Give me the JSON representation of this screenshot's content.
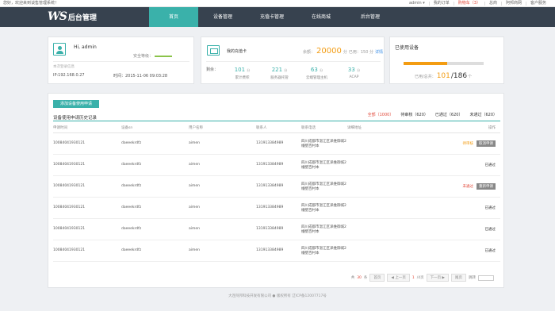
{
  "topbar": {
    "welcome": "您好，欢迎来到谈售管理系统！",
    "links": [
      "admin ▾",
      "我的订单",
      "购物车（3）",
      "总商",
      "阿邦商网",
      "客户服务"
    ]
  },
  "nav": {
    "logo_mark": "WS",
    "logo_text": "后台管理",
    "items": [
      "首页",
      "设备管理",
      "充值卡管理",
      "在线商城",
      "后台管理"
    ]
  },
  "user_card": {
    "greeting": "Hi, admin",
    "security_label": "安全等级：",
    "last_login_label": "本次登录信息",
    "ip": "IP:192.168.0.27",
    "time": "时间：2015-11-06 09:03:28"
  },
  "recharge_card": {
    "title": "我的充值卡",
    "balance_label": "余额：",
    "balance": "20000",
    "balance_unit": "分",
    "used": "已用：150 分",
    "detail": "详情",
    "remaining_label": "剩余：",
    "stats": [
      {
        "value": "101",
        "unit": "分",
        "label": "累计费积"
      },
      {
        "value": "221",
        "unit": "分",
        "label": "服务器托管"
      },
      {
        "value": "63",
        "unit": "分",
        "label": "云端管理主机"
      },
      {
        "value": "33",
        "unit": "分",
        "label": "ACAP"
      }
    ]
  },
  "device_card": {
    "title": "已使用设备",
    "used_fraction": 0.543,
    "count_label": "已用/总共：",
    "used": "101",
    "total": "/186",
    "unit": "个"
  },
  "main": {
    "apply_button": "添加设备使用申请",
    "record_title": "设备使用申请历史记录",
    "filters": [
      "全部（1000）",
      "待审核（620）",
      "已通过（620）",
      "未通过（620）"
    ],
    "columns": [
      "申请时间",
      "设备sn",
      "用户名称",
      "联系人",
      "联系电话",
      "详细地址",
      "操作"
    ],
    "rows": [
      {
        "time": "10084041930121",
        "sn": "daeeekrdfz",
        "user": "aimen",
        "contact": "131913384989",
        "phone": "四川成都市温江区泽维御城2幢壁百村本",
        "status": "待审核",
        "status_class": "wait",
        "action": "取消申请"
      },
      {
        "time": "10084041930121",
        "sn": "daeeekrdfz",
        "user": "aimen",
        "contact": "131913384989",
        "phone": "四川成都市温江区泽维御城2幢壁百村本",
        "status": "已通过",
        "status_class": "",
        "action": ""
      },
      {
        "time": "10084041930121",
        "sn": "daeeekrdfz",
        "user": "aimen",
        "contact": "131913384989",
        "phone": "四川成都市温江区泽维御城2幢壁百村本",
        "status": "未通过",
        "status_class": "no",
        "action": "重新申请"
      },
      {
        "time": "10084041930121",
        "sn": "daeeekrdfz",
        "user": "aimen",
        "contact": "131913384989",
        "phone": "四川成都市温江区泽维御城2幢壁百村本",
        "status": "已通过",
        "status_class": "",
        "action": ""
      },
      {
        "time": "10084041930121",
        "sn": "daeeekrdfz",
        "user": "aimen",
        "contact": "131913384989",
        "phone": "四川成都市温江区泽维御城2幢壁百村本",
        "status": "已通过",
        "status_class": "",
        "action": ""
      },
      {
        "time": "10084041930121",
        "sn": "daeeekrdfz",
        "user": "aimen",
        "contact": "131913384989",
        "phone": "四川成都市温江区泽维御城2幢壁百村本",
        "status": "已通过",
        "status_class": "",
        "action": ""
      }
    ],
    "pager": {
      "total_prefix": "共",
      "total": "30",
      "total_suffix": "条",
      "first": "首页",
      "prev": "◀ 上一页",
      "page": "1",
      "page_total": "/4页",
      "next": "下一页 ▶",
      "last": "尾页",
      "goto": "跳转"
    }
  },
  "footer": "大连阿邦科技开发有限公司 ● 版权所有 辽ICP备12007717号"
}
